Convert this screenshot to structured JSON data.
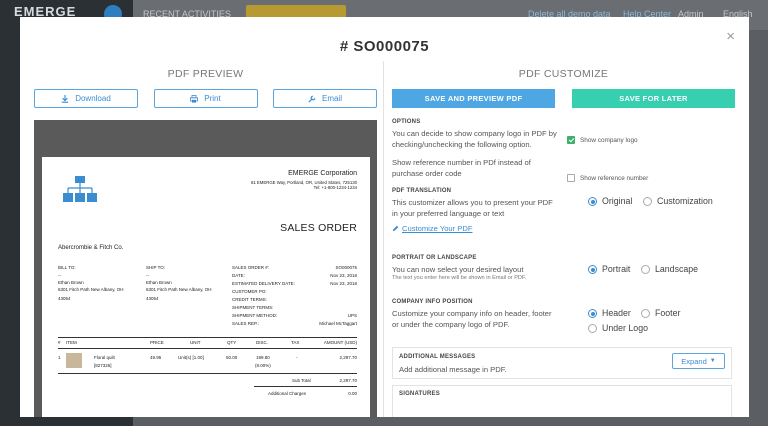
{
  "background": {
    "logo": "EMERGE",
    "recent_activities": "RECENT ACTIVITIES",
    "delete_demo": "Delete all demo data",
    "help_center": "Help Center",
    "user": "Admin",
    "language": "English"
  },
  "modal": {
    "title": "# SO000075",
    "close": "×"
  },
  "preview": {
    "heading": "PDF PREVIEW",
    "buttons": {
      "download": "Download",
      "print": "Print",
      "email": "Email"
    },
    "document": {
      "company_name": "EMERGE Corporation",
      "company_address": "81 EMERGE Way, Portland, OR, United States, 725130",
      "company_tel": "Tel: +1-800-1234-1234",
      "doc_title": "SALES ORDER",
      "customer_name": "Abercrombie & Fitch Co.",
      "bill_to_label": "BILL TO:",
      "bill_to_dash": "--",
      "bill_to_name": "Ethan Brown",
      "bill_to_address": "6301 Fitch Path New Albany, OH",
      "bill_to_zip": "43054",
      "ship_to_label": "SHIP TO:",
      "ship_to_dash": "--",
      "ship_to_name": "Ethan Brown",
      "ship_to_address": "6301 Fitch Path New Albany, OH",
      "ship_to_zip": "43054",
      "meta": [
        {
          "label": "SALES ORDER #:",
          "value": "SO000075"
        },
        {
          "label": "DATE:",
          "value": "Nov 23, 2018"
        },
        {
          "label": "ESTIMATED DELIVERY DATE:",
          "value": "Nov 23, 2018"
        },
        {
          "label": "CUSTOMER PO:",
          "value": ""
        },
        {
          "label": "CREDIT TERMS:",
          "value": ""
        },
        {
          "label": "SHIPMENT TERMS:",
          "value": ""
        },
        {
          "label": "SHIPMENT METHOD:",
          "value": "UPS"
        },
        {
          "label": "SALES REP.:",
          "value": "Michael McTaggart"
        }
      ],
      "table_headers": {
        "num": "#",
        "item": "ITEM",
        "price": "PRICE",
        "unit": "UNIT",
        "qty": "QTY",
        "disc": "DISC.",
        "tax": "TAX",
        "amount": "AMOUNT (USD)"
      },
      "row": {
        "num": "1",
        "item_name": "Floral quilt",
        "item_code": "[827326]",
        "price": "49.95",
        "unit": "Unit(s) [1.00]",
        "qty": "50.00",
        "disc": "199.80",
        "disc_pct": "(8.00%)",
        "tax": "-",
        "amount": "2,297.70"
      },
      "subtotal_label": "Sub Total",
      "subtotal_value": "2,297.70",
      "additional_label": "Additional Charges",
      "additional_value": "0.00"
    }
  },
  "customize": {
    "heading": "PDF CUSTOMIZE",
    "save_preview": "SAVE AND PREVIEW PDF",
    "save_later": "SAVE FOR LATER",
    "options": {
      "label": "OPTIONS",
      "logo_desc_1": "You can decide to show company logo in PDF by",
      "logo_desc_2": "checking/unchecking the following option.",
      "show_logo": "Show company logo",
      "ref_desc_1": "Show reference number in PDf instead of",
      "ref_desc_2": "purchase order code",
      "show_ref": "Show reference number"
    },
    "translation": {
      "label": "PDF TRANSLATION",
      "desc_1": "This customizer allows you to present your PDF",
      "desc_2": "in your preferred language or text",
      "link": "Customize Your PDF",
      "original": "Original",
      "customization": "Customization"
    },
    "orientation": {
      "label": "PORTRAIT OR LANDSCAPE",
      "desc": "You can now select your desired layout",
      "note": "The text you enter here will be shown in Email or PDF.",
      "portrait": "Portrait",
      "landscape": "Landscape"
    },
    "company_info": {
      "label": "COMPANY INFO POSITION",
      "desc_1": "Customize your company info on header, footer",
      "desc_2": "or under the company logo of PDF.",
      "header": "Header",
      "footer": "Footer",
      "under_logo": "Under Logo"
    },
    "additional": {
      "label": "ADDITIONAL MESSAGES",
      "desc": "Add additional message in PDF.",
      "expand": "Expand"
    },
    "signatures": {
      "label": "SIGNATURES"
    }
  },
  "colors": {
    "primary_blue": "#4ea7e2",
    "teal": "#36cfb0",
    "link": "#3c8cd1",
    "check_green": "#3bb26a"
  }
}
